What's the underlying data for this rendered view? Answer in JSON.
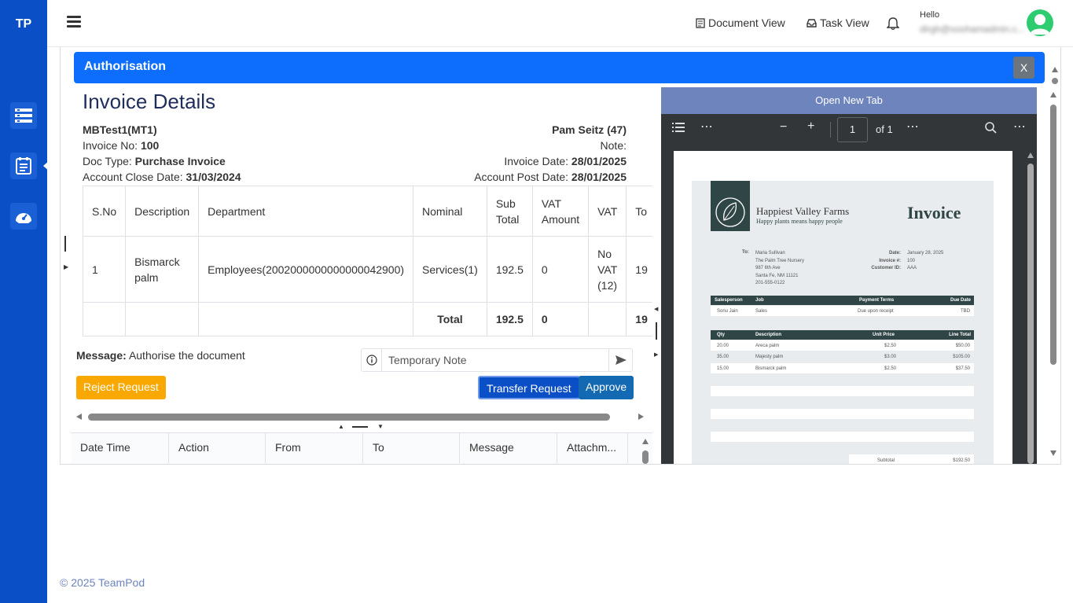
{
  "sidebar": {
    "brand": "TP",
    "icons": [
      "list-icon",
      "document-icon",
      "dashboard-icon"
    ]
  },
  "topbar": {
    "document_view": "Document View",
    "task_view": "Task View",
    "hello": "Hello",
    "user_email": "dirgh@soohamadmin.c..."
  },
  "modal": {
    "title": "Authorisation",
    "close": "X"
  },
  "invoice": {
    "title": "Invoice Details",
    "company": "MBTest1(MT1)",
    "invoice_no_label": "Invoice No:",
    "invoice_no": "100",
    "doc_type_label": "Doc Type:",
    "doc_type": "Purchase Invoice",
    "close_date_label": "Account Close Date:",
    "close_date": "31/03/2024",
    "contact": "Pam Seitz (47)",
    "note_label": "Note:",
    "invoice_date_label": "Invoice Date:",
    "invoice_date": "28/01/2025",
    "post_date_label": "Account Post Date:",
    "post_date": "28/01/2025"
  },
  "table": {
    "headers": [
      "S.No",
      "Description",
      "Department",
      "Nominal",
      "Sub Total",
      "VAT Amount",
      "VAT",
      "To"
    ],
    "row": [
      "1",
      "Bismarck palm",
      "Employees(2002000000000000042900)",
      "Services(1)",
      "192.5",
      "0",
      "No VAT (12)",
      "19"
    ],
    "total": {
      "label": "Total",
      "sub_total": "192.5",
      "vat_amount": "0",
      "to": "19"
    }
  },
  "message": {
    "label": "Message:",
    "text": "Authorise the document"
  },
  "note_input": {
    "placeholder": "Temporary Note"
  },
  "buttons": {
    "reject": "Reject Request",
    "transfer": "Transfer Request",
    "approve": "Approve"
  },
  "history": {
    "headers": [
      "Date Time",
      "Action",
      "From",
      "To",
      "Message",
      "Attachm..."
    ]
  },
  "pdf": {
    "open_new_tab": "Open New Tab",
    "page": "1",
    "of": "of 1",
    "company": "Happiest Valley Farms",
    "tagline": "Happy plants means happy people",
    "doc_title": "Invoice",
    "to_label": "To:",
    "to_lines": [
      "Maria Sullivan",
      "The Palm Tree Nursery",
      "987 6th Ave",
      "Santa Fe, NM 11121",
      "201-555-0122"
    ],
    "date_label": "Date:",
    "date": "January 28, 2025",
    "invoice_label": "Invoice #:",
    "invoice_no": "100",
    "customer_label": "Customer ID:",
    "customer_id": "AAA",
    "sales_headers": [
      "Salesperson",
      "Job",
      "Payment Terms",
      "Due Date"
    ],
    "sales_row": [
      "Sonu Jain",
      "Sales",
      "Due upon receipt",
      "TBD"
    ],
    "line_headers": [
      "Qty",
      "Description",
      "Unit Price",
      "Line Total"
    ],
    "lines": [
      [
        "20.00",
        "Areca palm",
        "$2.50",
        "$50.00"
      ],
      [
        "35.00",
        "Majesty palm",
        "$3.00",
        "$105.00"
      ],
      [
        "15.00",
        "Bismarck palm",
        "$2.50",
        "$37.50"
      ]
    ],
    "subtotal_label": "Subtotal",
    "subtotal": "$192.50"
  },
  "footer": "© 2025 TeamPod"
}
